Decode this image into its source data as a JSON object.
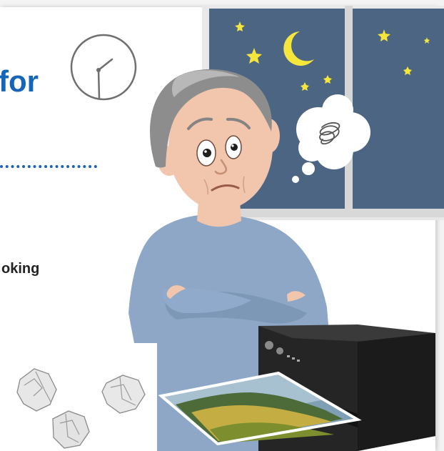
{
  "heading": {
    "fragment": "for",
    "icon": "clock-icon"
  },
  "body": {
    "fragment": "oking"
  },
  "illustration": {
    "subject": "worried-man-icon",
    "thought": "tangled-thought-icon",
    "window": "night-window-icon",
    "printer": "printer-icon",
    "crumpled_paper": "crumpled-paper-icon"
  },
  "colors": {
    "accent": "#1565b8",
    "night_sky": "#4b6583",
    "star": "#f5e63c",
    "shirt": "#8ea7c6",
    "printer": "#2b2b2b"
  }
}
